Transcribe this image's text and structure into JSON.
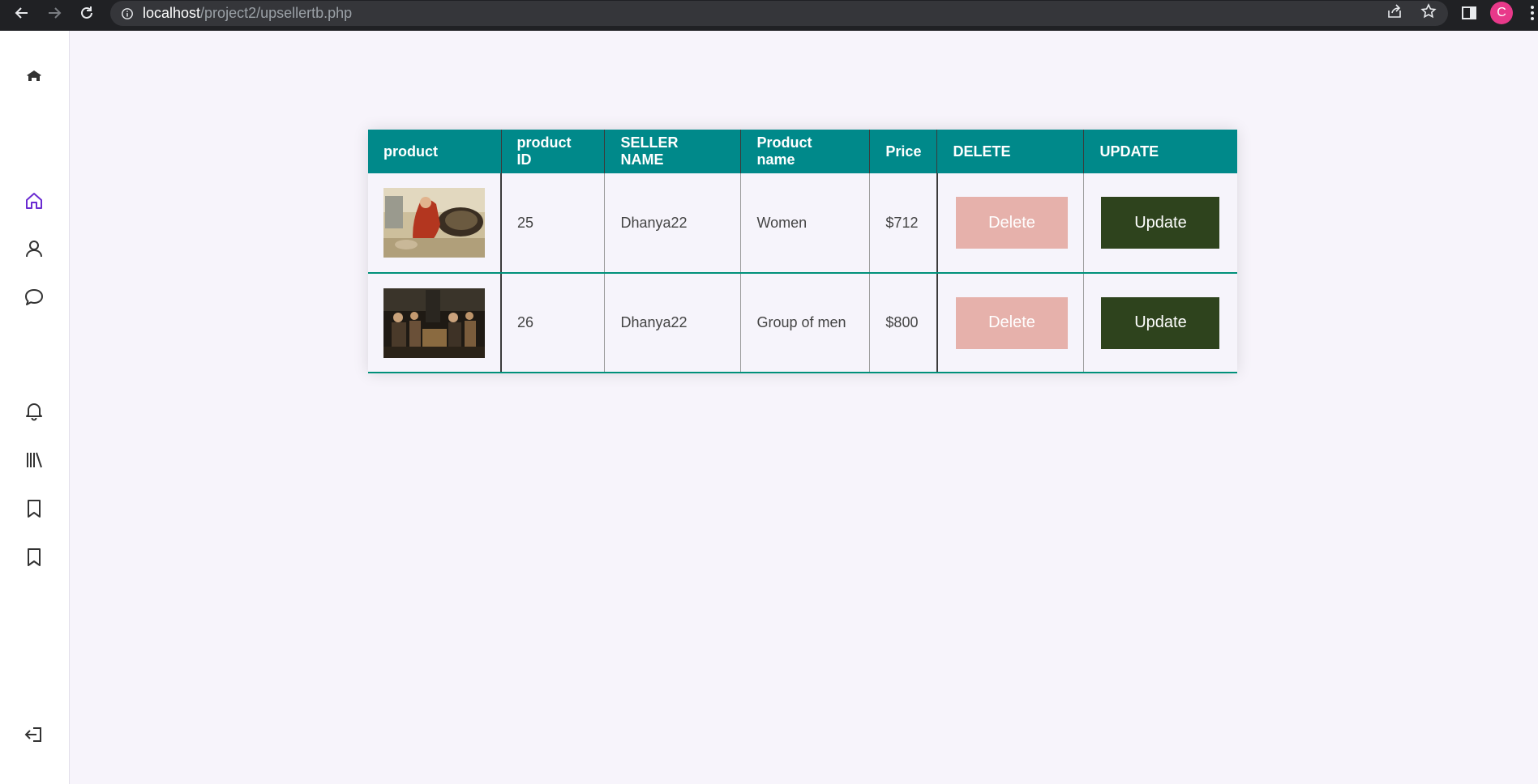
{
  "browser": {
    "url_host": "localhost",
    "url_path": "/project2/upsellertb.php",
    "profile_initial": "C",
    "profile_color": "#e8398a"
  },
  "sidebar": {
    "items": [
      {
        "icon": "graduation-home-icon"
      },
      {
        "icon": "home-icon",
        "active": true
      },
      {
        "icon": "user-icon"
      },
      {
        "icon": "chat-icon"
      },
      {
        "icon": "bell-icon"
      },
      {
        "icon": "library-icon"
      },
      {
        "icon": "bookmark-icon"
      },
      {
        "icon": "bookmark-icon"
      },
      {
        "icon": "logout-icon"
      }
    ],
    "accent_color": "#6a2bd1"
  },
  "table": {
    "header_color": "#00898a",
    "headers": [
      "product",
      "product ID",
      "SELLER NAME",
      "Product name",
      "Price",
      "DELETE",
      "UPDATE"
    ],
    "rows": [
      {
        "product_image": "painting-woman-sifting-grain",
        "product_id": "25",
        "seller_name": "Dhanya22",
        "product_name": "Women",
        "price": "$712",
        "delete_label": "Delete",
        "update_label": "Update"
      },
      {
        "product_image": "painting-group-of-men",
        "product_id": "26",
        "seller_name": "Dhanya22",
        "product_name": "Group of men",
        "price": "$800",
        "delete_label": "Delete",
        "update_label": "Update"
      }
    ]
  }
}
